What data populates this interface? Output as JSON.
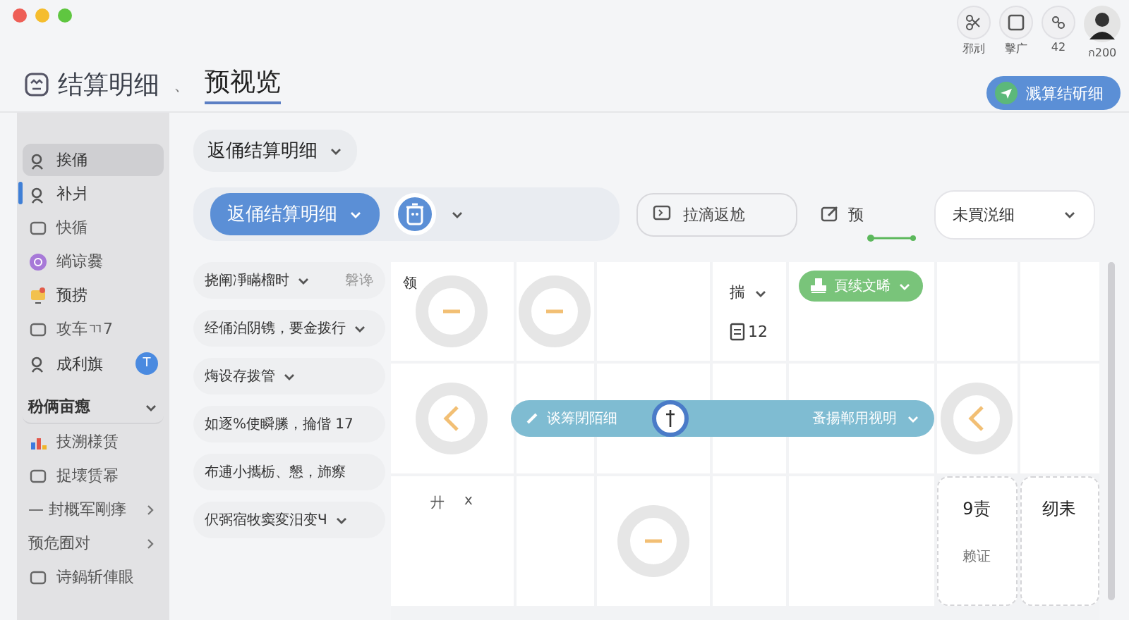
{
  "window": {
    "controls": [
      {
        "color": "#ee5f57"
      },
      {
        "color": "#f5bd2e"
      },
      {
        "color": "#5fc640"
      }
    ]
  },
  "header": {
    "title": "结算明细",
    "separator": "、",
    "subtitle": "预视览",
    "tools": [
      {
        "label": "邪刓"
      },
      {
        "label": "擊广"
      },
      {
        "label": "42"
      },
      {
        "label": "ก200"
      }
    ],
    "primary_button": "溅算结斫细"
  },
  "sidebar": {
    "items": [
      {
        "kind": "item",
        "label": "挨俑",
        "selected": true,
        "indicator": false
      },
      {
        "kind": "item",
        "label": "补爿",
        "selected": false,
        "indicator": true
      },
      {
        "kind": "small",
        "label": "快循",
        "selected": false,
        "indicator": false
      },
      {
        "kind": "small",
        "label": "绱谅爨",
        "selected": false,
        "indicator": false
      },
      {
        "kind": "item",
        "label": "预捞",
        "selected": false,
        "indicator": false
      },
      {
        "kind": "small",
        "label": "攻车ㄲ7",
        "selected": false,
        "indicator": false
      },
      {
        "kind": "item",
        "label": "成利旗",
        "selected": false,
        "indicator": false,
        "badge": "T"
      },
      {
        "kind": "section",
        "label": "秎俩亩瘛",
        "selected": false,
        "indicator": false
      },
      {
        "kind": "small",
        "label": "技溯様赁",
        "selected": false,
        "indicator": false
      },
      {
        "kind": "small",
        "label": "捉壊赁幂",
        "selected": false,
        "indicator": false
      },
      {
        "kind": "sub",
        "label": "— 封概军剛痵",
        "selected": false,
        "indicator": false
      },
      {
        "kind": "sub",
        "label": "预危囿对",
        "selected": false,
        "indicator": false
      },
      {
        "kind": "small",
        "label": "诗鍋斩俥眼",
        "selected": false,
        "indicator": false
      }
    ]
  },
  "toolbar": {
    "dropdown": "返俑结算明细",
    "pill": "返俑结算明细",
    "action": "拉滴返尬",
    "preview": "预",
    "view": "未買涚细"
  },
  "list": [
    {
      "label": "挠阐凈瞞榴时",
      "hint": "磐谗",
      "chevron": true
    },
    {
      "label": "经俑泊阴镌，要金拨行",
      "chevron": true
    },
    {
      "label": "烸设存拨管",
      "chevron": true
    },
    {
      "label": "如逐%使瞬縢，掄偕 17",
      "chevron": false
    },
    {
      "label": "布逋小攜栃、懇，斾瘵",
      "chevron": false
    },
    {
      "label": "伬弼宿牧窦変汨变Ч",
      "chevron": true
    }
  ],
  "grid": {
    "rows": [
      {
        "cells": [
          {
            "kind": "tag",
            "text": "领"
          },
          {
            "kind": "ring"
          },
          {
            "kind": "blank"
          },
          {
            "kind": "stack",
            "text": "揣",
            "count": "12"
          },
          {
            "kind": "pill",
            "text": "頁续文晞"
          },
          {
            "kind": "blank"
          },
          {
            "kind": "blank"
          }
        ]
      },
      {
        "cells": [
          {
            "kind": "arrow"
          },
          {
            "kind": "blank"
          },
          {
            "kind": "blank"
          },
          {
            "kind": "blank"
          },
          {
            "kind": "blank"
          },
          {
            "kind": "arrow"
          },
          {
            "kind": "blank"
          }
        ],
        "band": {
          "left": "谈筹閉陌细",
          "right": "蚤揚郸用视明"
        }
      },
      {
        "cells": [
          {
            "kind": "chip",
            "text": "廾",
            "close": "x"
          },
          {
            "kind": "blank"
          },
          {
            "kind": "ring"
          },
          {
            "kind": "blank"
          },
          {
            "kind": "blank"
          },
          {
            "kind": "dashed",
            "text": "9责",
            "note": "赖证"
          },
          {
            "kind": "dashed",
            "text": "纫耒"
          }
        ]
      }
    ]
  }
}
